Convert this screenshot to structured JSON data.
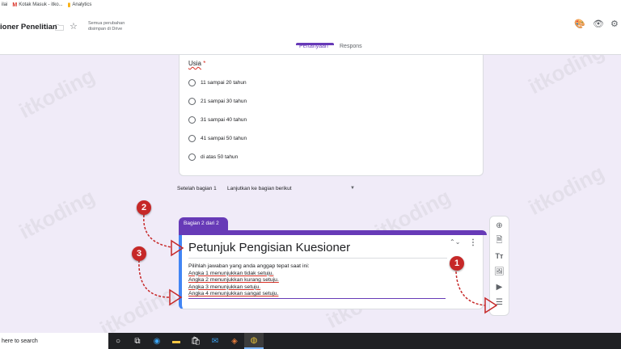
{
  "bookmarks": [
    {
      "label": "ilai",
      "icon": "bookmark-icon"
    },
    {
      "label": "Kotak Masuk - itko...",
      "icon": "gmail-icon"
    },
    {
      "label": "Analytics",
      "icon": "analytics-icon"
    }
  ],
  "header": {
    "doc_title": "ioner Penelitian",
    "save_note": "Semua perubahan disimpan di Drive",
    "tabs": [
      {
        "label": "Pertanyaan",
        "active": true
      },
      {
        "label": "Respons",
        "active": false
      }
    ]
  },
  "question": {
    "title": "Usia",
    "required_mark": "*",
    "options": [
      "11 sampai 20 tahun",
      "21 sampai 30 tahun",
      "31 sampai 40 tahun",
      "41 sampai 50 tahun",
      "di atas 50 tahun"
    ]
  },
  "after_section": {
    "label": "Setelah bagian 1",
    "value": "Lanjutkan ke bagian berikut"
  },
  "section": {
    "tab_label": "Bagian 2 dari 2",
    "title": "Petunjuk Pengisian Kuesioner",
    "description": [
      "Pilihlah jawaban yang anda anggap tepat saat ini:",
      "Angka 1 menunjukkan tidak setuju.",
      "Angka 2 menunjukkan kurang setuju.",
      "Angka 3 menunjukkan setuju.",
      "Angka 4 menunjukkan sangat setuju."
    ]
  },
  "markers": [
    "1",
    "2",
    "3"
  ],
  "watermark_text": "itkoding",
  "taskbar": {
    "search_text": "here to search"
  },
  "colors": {
    "accent": "#673ab7",
    "background": "#f0ebf8",
    "marker": "#c62828"
  }
}
